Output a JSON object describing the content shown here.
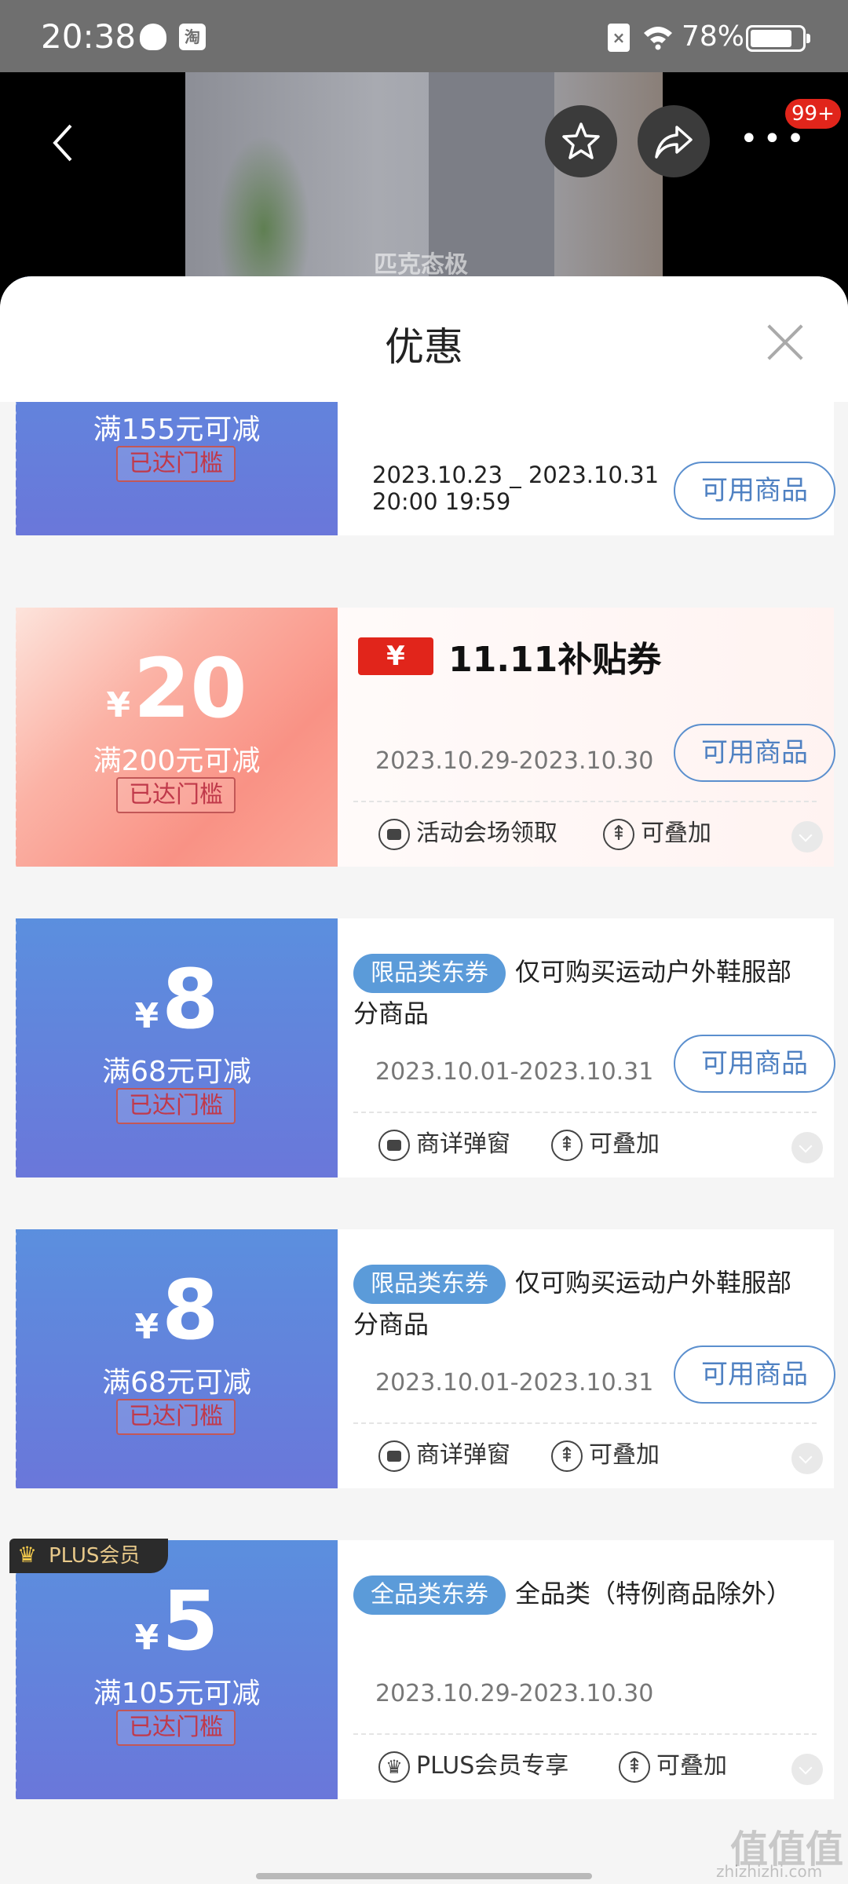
{
  "status_bar": {
    "time": "20:38",
    "taobao_label": "淘",
    "battery": "78%"
  },
  "product": {
    "brand_watermark": "匹克态极",
    "more_badge": "99+"
  },
  "sheet": {
    "title": "优惠"
  },
  "coupons": [
    {
      "condition": "满155元可减",
      "reached": "已达门槛",
      "date_line1": "2023.10.23 _ 2023.10.31",
      "date_line2": "20:00 19:59",
      "use_button": "可用商品"
    },
    {
      "currency": "¥",
      "amount": "20",
      "condition": "满200元可减",
      "reached": "已达门槛",
      "promo_logo_symbol": "¥",
      "promo_title": "11.11补贴券",
      "date_range": "2023.10.29-2023.10.30",
      "use_button": "可用商品",
      "meta1": "活动会场领取",
      "meta2": "可叠加"
    },
    {
      "currency": "¥",
      "amount": "8",
      "condition": "满68元可减",
      "reached": "已达门槛",
      "tag": "限品类东券",
      "description": "仅可购买运动户外鞋服部分商品",
      "date_range": "2023.10.01-2023.10.31",
      "use_button": "可用商品",
      "meta1": "商详弹窗",
      "meta2": "可叠加"
    },
    {
      "currency": "¥",
      "amount": "8",
      "condition": "满68元可减",
      "reached": "已达门槛",
      "tag": "限品类东券",
      "description": "仅可购买运动户外鞋服部分商品",
      "date_range": "2023.10.01-2023.10.31",
      "use_button": "可用商品",
      "meta1": "商详弹窗",
      "meta2": "可叠加"
    },
    {
      "badge": "PLUS会员",
      "currency": "¥",
      "amount": "5",
      "condition": "满105元可减",
      "reached": "已达门槛",
      "tag": "全品类东券",
      "description": "全品类（特例商品除外）",
      "date_range": "2023.10.29-2023.10.30",
      "meta1": "PLUS会员专享",
      "meta2": "可叠加"
    }
  ],
  "watermark": {
    "text": "值值值",
    "sub": "zhizhizhi.com"
  }
}
